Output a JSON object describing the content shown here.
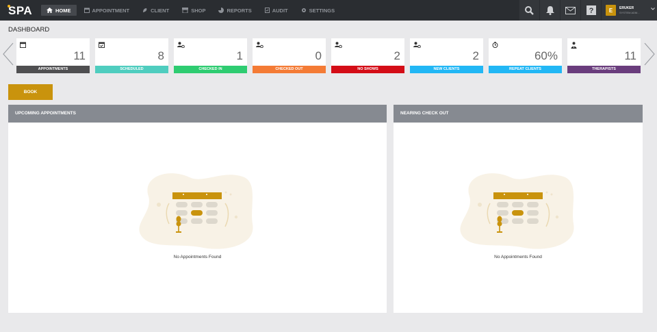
{
  "app": {
    "logo": "SPA"
  },
  "nav": [
    {
      "label": "HOME",
      "icon": "home-icon"
    },
    {
      "label": "APPOINTMENT",
      "icon": "calendar-icon"
    },
    {
      "label": "CLIENT",
      "icon": "client-icon"
    },
    {
      "label": "SHOP",
      "icon": "shop-icon"
    },
    {
      "label": "REPORTS",
      "icon": "reports-icon"
    },
    {
      "label": "AUDIT",
      "icon": "audit-icon"
    },
    {
      "label": "SETTINGS",
      "icon": "gear-icon"
    }
  ],
  "user": {
    "initial": "E",
    "name": "ERUKER",
    "role": "SYSTEM ADM..."
  },
  "page": {
    "title": "DASHBOARD"
  },
  "stats": [
    {
      "value": "11",
      "label": "APPOINTMENTS",
      "color": "#4f4f51",
      "icon": "calendar-icon"
    },
    {
      "value": "8",
      "label": "SCHEDULED",
      "color": "#4fcdbf",
      "icon": "calendar-check-icon"
    },
    {
      "value": "1",
      "label": "CHECKED IN",
      "color": "#2ecc71",
      "icon": "user-clock-icon"
    },
    {
      "value": "0",
      "label": "CHECKED OUT",
      "color": "#f47b35",
      "icon": "user-clock-icon"
    },
    {
      "value": "2",
      "label": "NO SHOWS",
      "color": "#d40d17",
      "icon": "user-clock-icon"
    },
    {
      "value": "2",
      "label": "NEW CLIENTS",
      "color": "#22b7f5",
      "icon": "user-clock-icon"
    },
    {
      "value": "60%",
      "label": "REPEAT CLIENTS",
      "color": "#22b7f5",
      "icon": "repeat-icon"
    },
    {
      "value": "11",
      "label": "THERAPISTS",
      "color": "#6a3d7d",
      "icon": "therapist-icon"
    }
  ],
  "actions": {
    "book": "BOOK"
  },
  "panels": {
    "upcoming": {
      "title": "UPCOMING APPOINTMENTS",
      "empty": "No Appointments Found"
    },
    "checkout": {
      "title": "NEARING CHECK OUT",
      "empty": "No Appointments Found"
    }
  }
}
